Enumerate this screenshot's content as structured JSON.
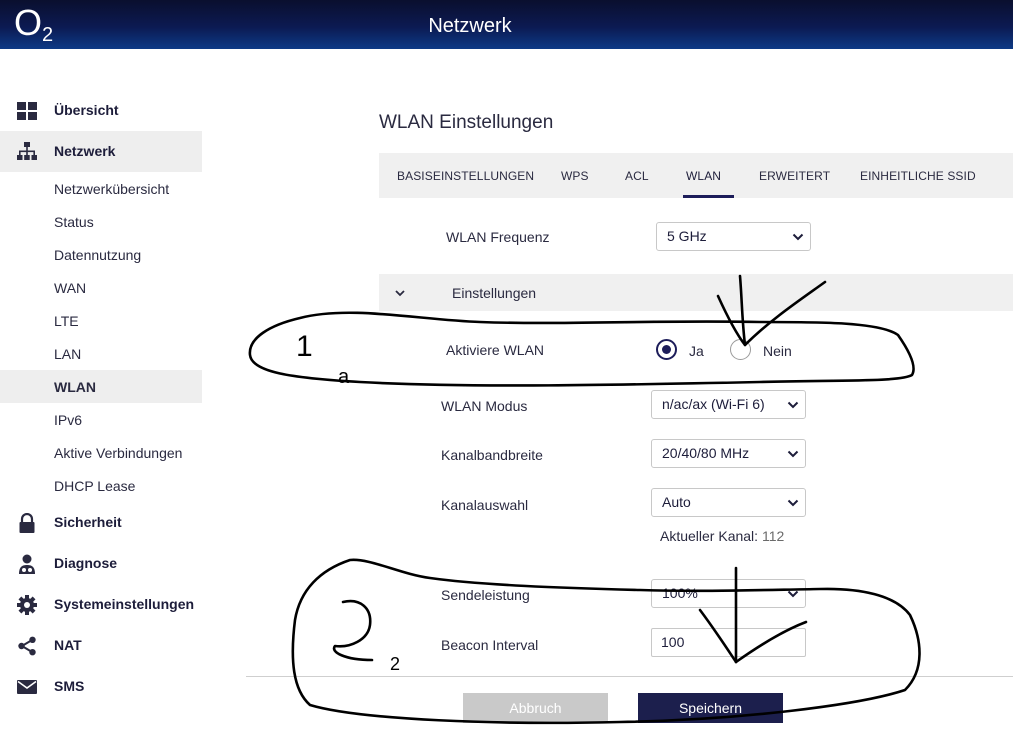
{
  "header": {
    "logo": "O",
    "logo_sub": "2",
    "title": "Netzwerk"
  },
  "sidebar": {
    "items": [
      {
        "label": "Übersicht",
        "icon": "dashboard-icon"
      },
      {
        "label": "Netzwerk",
        "icon": "network-icon",
        "active": true
      },
      {
        "label": "Netzwerkübersicht"
      },
      {
        "label": "Status"
      },
      {
        "label": "Datennutzung"
      },
      {
        "label": "WAN"
      },
      {
        "label": "LTE"
      },
      {
        "label": "LAN"
      },
      {
        "label": "WLAN",
        "active": true
      },
      {
        "label": "IPv6"
      },
      {
        "label": "Aktive Verbindungen"
      },
      {
        "label": "DHCP Lease"
      },
      {
        "label": "Sicherheit",
        "icon": "lock-icon"
      },
      {
        "label": "Diagnose",
        "icon": "doctor-icon"
      },
      {
        "label": "Systemeinstellungen",
        "icon": "gear-icon"
      },
      {
        "label": "NAT",
        "icon": "share-icon"
      },
      {
        "label": "SMS",
        "icon": "mail-icon"
      }
    ]
  },
  "page_title": "WLAN Einstellungen",
  "tabs": [
    "BASISEINSTELLUNGEN",
    "WPS",
    "ACL",
    "WLAN",
    "ERWEITERT",
    "EINHEITLICHE SSID"
  ],
  "active_tab": "WLAN",
  "frequency": {
    "label": "WLAN Frequenz",
    "value": "5 GHz"
  },
  "section": {
    "label": "Einstellungen"
  },
  "enable_wlan": {
    "label": "Aktiviere WLAN",
    "yes": "Ja",
    "no": "Nein",
    "selected": "Ja"
  },
  "mode": {
    "label": "WLAN Modus",
    "value": "n/ac/ax (Wi-Fi 6)"
  },
  "bandwidth": {
    "label": "Kanalbandbreite",
    "value": "20/40/80 MHz"
  },
  "channel_select": {
    "label": "Kanalauswahl",
    "value": "Auto"
  },
  "current_channel": {
    "label": "Aktueller Kanal:",
    "value": "112"
  },
  "tx_power": {
    "label": "Sendeleistung",
    "value": "100%"
  },
  "beacon": {
    "label": "Beacon Interval",
    "value": "100"
  },
  "buttons": {
    "cancel": "Abbruch",
    "save": "Speichern"
  },
  "annotations": {
    "mark_1": "1",
    "mark_1_suffix": "a",
    "mark_2": "2"
  },
  "colors": {
    "header_dark": "#0a0f2e",
    "header_light": "#0d3a86",
    "accent": "#1d1d5a",
    "button_save": "#1c1f4d",
    "button_cancel": "#c9c9c9"
  }
}
